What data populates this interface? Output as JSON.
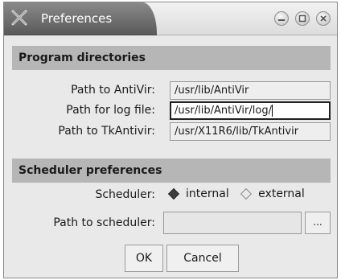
{
  "window": {
    "title": "Preferences",
    "controls": {
      "minimize": "minimize-icon",
      "maximize": "maximize-icon",
      "close": "close-icon"
    }
  },
  "program_directories": {
    "header": "Program directories",
    "rows": [
      {
        "label": "Path to AntiVir:",
        "value": "/usr/lib/AntiVir"
      },
      {
        "label": "Path for log file:",
        "value": "/usr/lib/AntiVir/log/"
      },
      {
        "label": "Path to TkAntivir:",
        "value": "/usr/X11R6/lib/TkAntivir"
      }
    ]
  },
  "scheduler_preferences": {
    "header": "Scheduler preferences",
    "scheduler_label": "Scheduler:",
    "options": [
      {
        "label": "internal",
        "selected": true
      },
      {
        "label": "external",
        "selected": false
      }
    ],
    "path_label": "Path to scheduler:",
    "path_value": "",
    "browse_label": "..."
  },
  "buttons": {
    "ok": "OK",
    "cancel": "Cancel"
  }
}
